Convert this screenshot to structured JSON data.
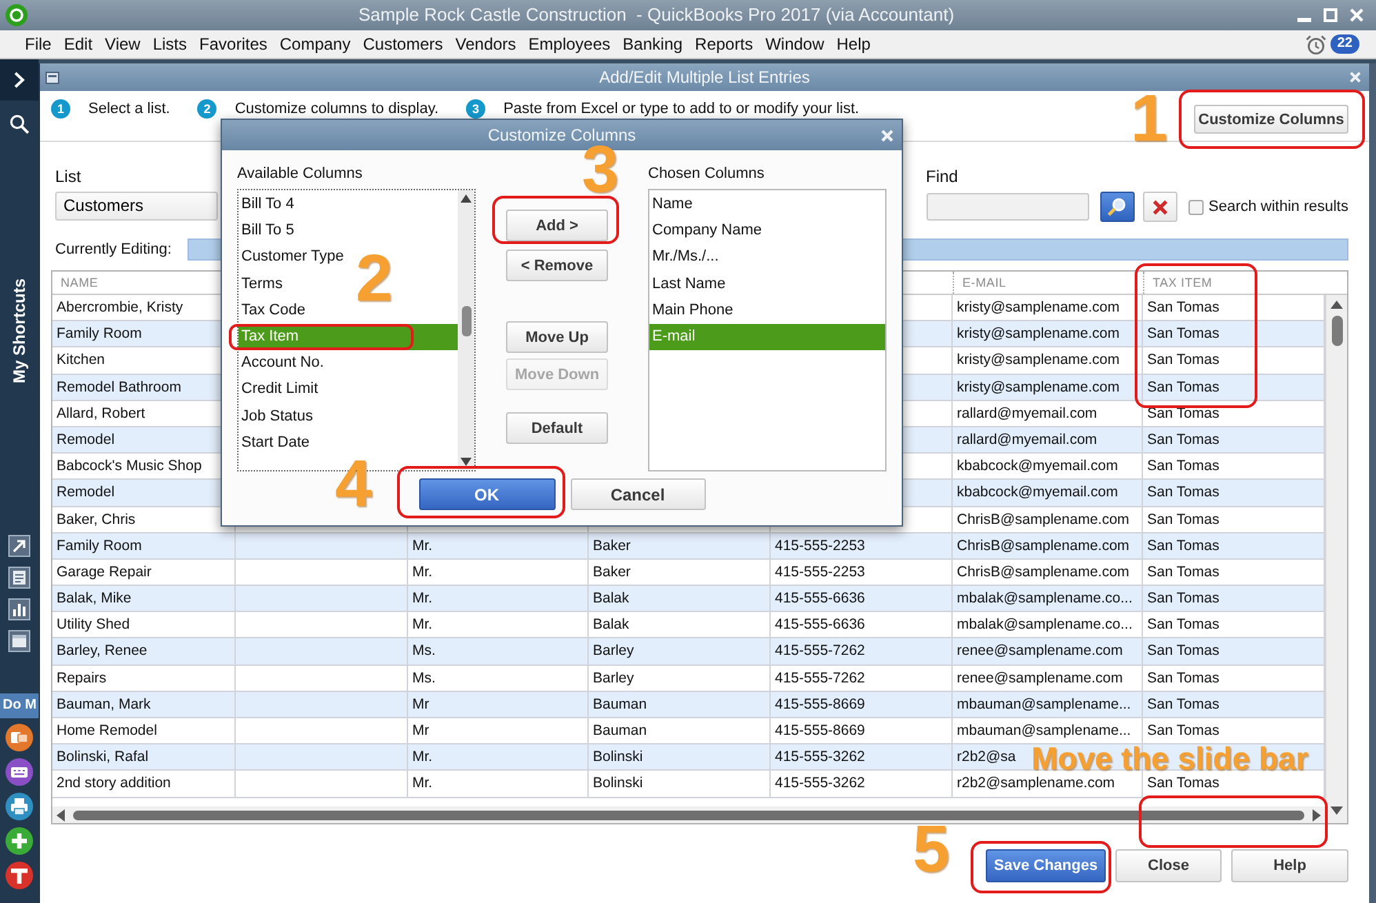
{
  "app": {
    "title": "Sample Rock Castle Construction  - QuickBooks Pro 2017 (via Accountant)",
    "menu": [
      "File",
      "Edit",
      "View",
      "Lists",
      "Favorites",
      "Company",
      "Customers",
      "Vendors",
      "Employees",
      "Banking",
      "Reports",
      "Window",
      "Help"
    ],
    "reminder_count": "22"
  },
  "sidebar": {
    "heading": "My Shortcuts",
    "section": "Do M"
  },
  "editor": {
    "title": "Add/Edit Multiple List Entries",
    "steps": [
      {
        "number": "1",
        "text": "Select a list."
      },
      {
        "number": "2",
        "text": "Customize columns to display."
      },
      {
        "number": "3",
        "text": "Paste from Excel or type to add to or modify your list."
      }
    ],
    "customize_button": "Customize Columns",
    "list": {
      "label": "List",
      "value": "Customers"
    },
    "find": {
      "label": "Find"
    },
    "search_within": {
      "label": "Search within results",
      "checked": false
    },
    "currently_editing": {
      "label": "Currently Editing:"
    },
    "table": {
      "headers": {
        "name": "NAME",
        "e_mail": "E-MAIL",
        "tax_item": "TAX ITEM"
      },
      "rows": [
        {
          "name": "Abercrombie, Kristy",
          "e_mail": "kristy@samplename.com",
          "tax_item": "San Tomas"
        },
        {
          "name": "Family Room",
          "e_mail": "kristy@samplename.com",
          "tax_item": "San Tomas"
        },
        {
          "name": "Kitchen",
          "e_mail": "kristy@samplename.com",
          "tax_item": "San Tomas"
        },
        {
          "name": "Remodel Bathroom",
          "e_mail": "kristy@samplename.com",
          "tax_item": "San Tomas"
        },
        {
          "name": "Allard, Robert",
          "e_mail": "rallard@myemail.com",
          "tax_item": "San Tomas"
        },
        {
          "name": "Remodel",
          "e_mail": "rallard@myemail.com",
          "tax_item": "San Tomas"
        },
        {
          "name": "Babcock's Music Shop",
          "e_mail": "kbabcock@myemail.com",
          "tax_item": "San Tomas"
        },
        {
          "name": "Remodel",
          "e_mail": "kbabcock@myemail.com",
          "tax_item": "San Tomas"
        },
        {
          "name": "Baker, Chris",
          "e_mail": "ChrisB@samplename.com",
          "tax_item": "San Tomas"
        },
        {
          "name": "Family Room",
          "column_3": "Mr.",
          "column_4": "Baker",
          "column_5": "415-555-2253",
          "e_mail": "ChrisB@samplename.com",
          "tax_item": "San Tomas"
        },
        {
          "name": "Garage Repair",
          "column_3": "Mr.",
          "column_4": "Baker",
          "column_5": "415-555-2253",
          "e_mail": "ChrisB@samplename.com",
          "tax_item": "San Tomas"
        },
        {
          "name": "Balak, Mike",
          "column_3": "Mr.",
          "column_4": "Balak",
          "column_5": "415-555-6636",
          "e_mail": "mbalak@samplename.co...",
          "tax_item": "San Tomas"
        },
        {
          "name": "Utility Shed",
          "column_3": "Mr.",
          "column_4": "Balak",
          "column_5": "415-555-6636",
          "e_mail": "mbalak@samplename.co...",
          "tax_item": "San Tomas"
        },
        {
          "name": "Barley, Renee",
          "column_3": "Ms.",
          "column_4": "Barley",
          "column_5": "415-555-7262",
          "e_mail": "renee@samplename.com",
          "tax_item": "San Tomas"
        },
        {
          "name": "Repairs",
          "column_3": "Ms.",
          "column_4": "Barley",
          "column_5": "415-555-7262",
          "e_mail": "renee@samplename.com",
          "tax_item": "San Tomas"
        },
        {
          "name": "Bauman, Mark",
          "column_3": "Mr",
          "column_4": "Bauman",
          "column_5": "415-555-8669",
          "e_mail": "mbauman@samplename...",
          "tax_item": "San Tomas"
        },
        {
          "name": "Home Remodel",
          "column_3": "Mr",
          "column_4": "Bauman",
          "column_5": "415-555-8669",
          "e_mail": "mbauman@samplename...",
          "tax_item": "San Tomas"
        },
        {
          "name": "Bolinski, Rafal",
          "column_3": "Mr.",
          "column_4": "Bolinski",
          "column_5": "415-555-3262",
          "e_mail": "r2b2@sa"
        },
        {
          "name": "2nd story addition",
          "column_3": "Mr.",
          "column_4": "Bolinski",
          "column_5": "415-555-3262",
          "e_mail": "r2b2@samplename.com",
          "tax_item": "San Tomas"
        }
      ]
    },
    "buttons": [
      {
        "label": "Save Changes",
        "kind": "primary"
      },
      {
        "label": "Close",
        "kind": "normal"
      },
      {
        "label": "Help",
        "kind": "normal"
      }
    ]
  },
  "dialog": {
    "title": "Customize Columns",
    "available": {
      "label": "Available Columns",
      "items": [
        {
          "label": "Bill To 4",
          "selected": false
        },
        {
          "label": "Bill To 5",
          "selected": false
        },
        {
          "label": "Customer Type",
          "selected": false
        },
        {
          "label": "Terms",
          "selected": false
        },
        {
          "label": "Tax Code",
          "selected": false
        },
        {
          "label": "Tax Item",
          "selected": true
        },
        {
          "label": "Account No.",
          "selected": false
        },
        {
          "label": "Credit Limit",
          "selected": false
        },
        {
          "label": "Job Status",
          "selected": false
        },
        {
          "label": "Start Date",
          "selected": false
        }
      ]
    },
    "actions": [
      {
        "label": "Add >",
        "disabled": false
      },
      {
        "label": "< Remove",
        "disabled": false
      },
      {
        "label": "Move Up",
        "disabled": false
      },
      {
        "label": "Move Down",
        "disabled": true
      },
      {
        "label": "Default",
        "disabled": false
      }
    ],
    "chosen": {
      "label": "Chosen Columns",
      "items": [
        {
          "label": "Name",
          "selected": false
        },
        {
          "label": "Company Name",
          "selected": false
        },
        {
          "label": "Mr./Ms./...",
          "selected": false
        },
        {
          "label": "Last Name",
          "selected": false
        },
        {
          "label": "Main Phone",
          "selected": false
        },
        {
          "label": "E-mail",
          "selected": true
        }
      ]
    },
    "buttons": [
      {
        "label": "OK",
        "kind": "primary"
      },
      {
        "label": "Cancel",
        "kind": "normal"
      }
    ]
  },
  "annotations": {
    "numbers": [
      "1",
      "2",
      "3",
      "4",
      "5"
    ],
    "note": "Move the slide bar"
  }
}
